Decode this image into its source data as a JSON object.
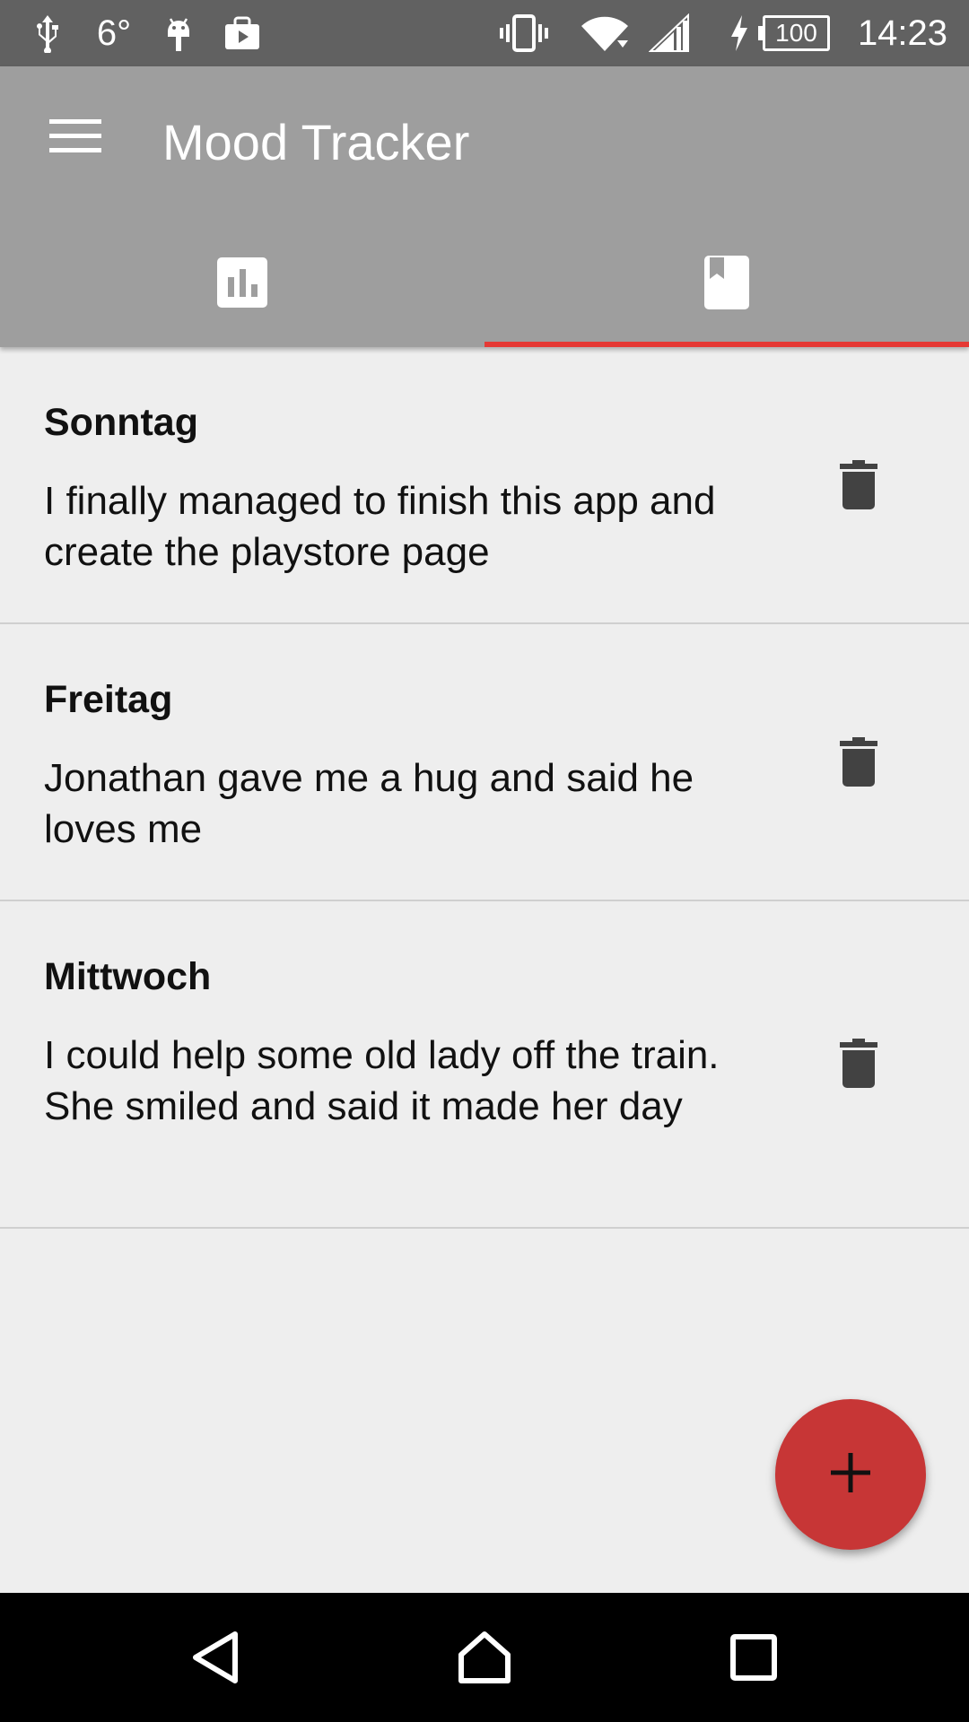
{
  "status_bar": {
    "temperature": "6°",
    "battery": "100",
    "time": "14:23",
    "icons": [
      "usb-icon",
      "android-icon",
      "store-icon",
      "vibrate-icon",
      "wifi-icon",
      "signal-icon",
      "charging-icon",
      "battery-icon"
    ]
  },
  "app_bar": {
    "title": "Mood Tracker",
    "menu_icon": "hamburger-menu-icon",
    "tabs": [
      {
        "icon": "bar-chart-icon",
        "selected": false
      },
      {
        "icon": "bookmark-book-icon",
        "selected": true
      }
    ],
    "indicator_color": "#e53935"
  },
  "entries": [
    {
      "day": "Sonntag",
      "text": "I finally managed to finish this app and create the playstore page"
    },
    {
      "day": "Freitag",
      "text": "Jonathan gave me a hug and said he loves me"
    },
    {
      "day": "Mittwoch",
      "text": "I could help some old lady off the train. She smiled and said it made her day"
    }
  ],
  "fab": {
    "icon": "plus-icon",
    "color": "#c73636"
  },
  "nav_bar": {
    "buttons": [
      "back-icon",
      "home-icon",
      "recents-icon"
    ]
  }
}
